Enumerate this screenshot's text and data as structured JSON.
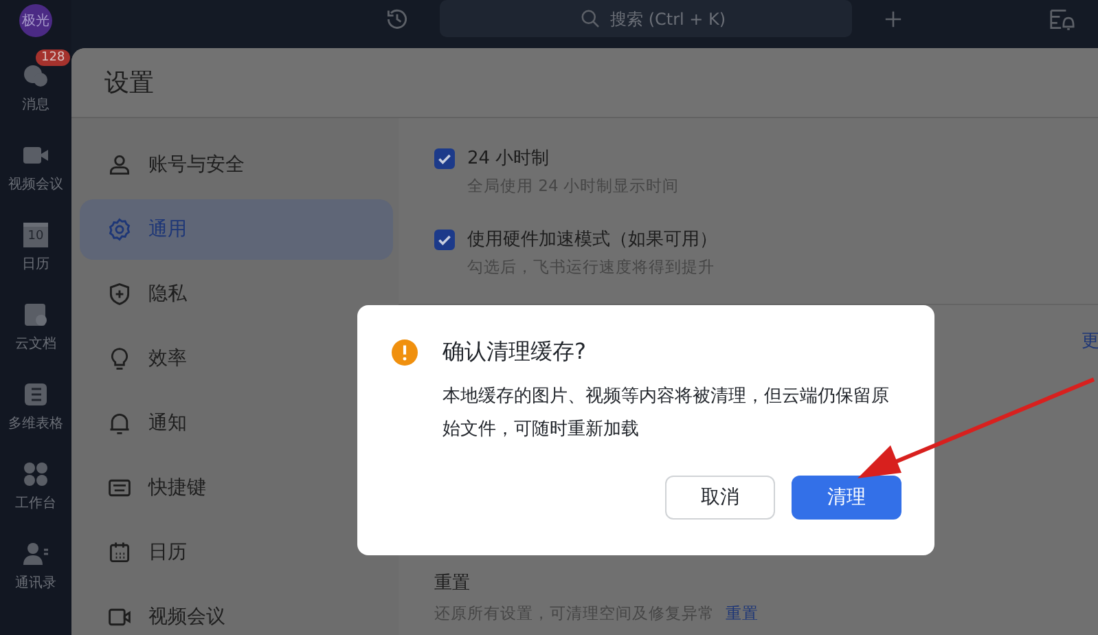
{
  "rail": {
    "avatar": "极光",
    "items": [
      {
        "label": "消息",
        "badge": "128"
      },
      {
        "label": "视频会议"
      },
      {
        "label": "日历",
        "icon_text": "10"
      },
      {
        "label": "云文档"
      },
      {
        "label": "多维表格"
      },
      {
        "label": "工作台"
      },
      {
        "label": "通讯录"
      }
    ]
  },
  "top_bar": {
    "search": {
      "placeholder": "搜索 (Ctrl + K)"
    }
  },
  "settings": {
    "title": "设置",
    "menu": [
      {
        "label": "账号与安全",
        "selected": false
      },
      {
        "label": "通用",
        "selected": true
      },
      {
        "label": "隐私",
        "selected": false
      },
      {
        "label": "效率",
        "selected": false
      },
      {
        "label": "通知",
        "selected": false
      },
      {
        "label": "快捷键",
        "selected": false
      },
      {
        "label": "日历",
        "selected": false
      },
      {
        "label": "视频会议",
        "selected": false
      }
    ],
    "options": [
      {
        "title": "24 小时制",
        "description": "全局使用 24 小时制显示时间",
        "checked": true
      },
      {
        "title": "使用硬件加速模式（如果可用）",
        "description": "勾选后，飞书运行速度将得到提升",
        "checked": true
      }
    ],
    "cut_link": "更",
    "reset": {
      "title": "重置",
      "description": "还原所有设置，可清理空间及修复异常",
      "link": "重置"
    }
  },
  "dialog": {
    "title": "确认清理缓存?",
    "message": "本地缓存的图片、视频等内容将被清理，但云端仍保留原始文件，可随时重新加载",
    "buttons": [
      {
        "label": "取消",
        "kind": "secondary"
      },
      {
        "label": "清理",
        "kind": "primary"
      }
    ]
  }
}
